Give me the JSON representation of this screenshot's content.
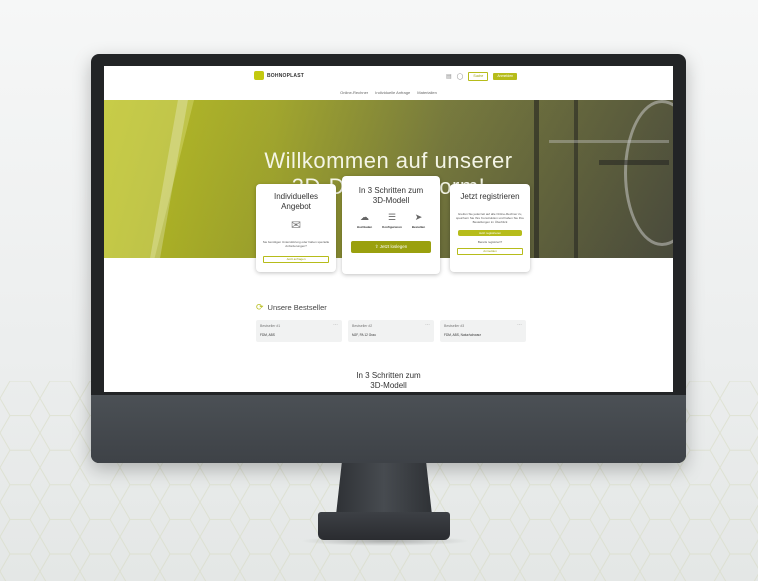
{
  "site": {
    "logo_text": "BOHNOPLAST"
  },
  "topbar": {
    "icon_compare": "chart-icon",
    "icon_user": "user-icon",
    "search_label": "Suche",
    "login_label": "Anmelden"
  },
  "nav": {
    "items": [
      "Online-Rechner",
      "Individuelle Anfrage",
      "Materialien"
    ]
  },
  "hero": {
    "title_line1": "Willkommen auf unserer",
    "title_line2": "3D-Druckplattform!"
  },
  "cards": {
    "individual": {
      "title_line1": "Individuelles",
      "title_line2": "Angebot",
      "text": "Sie benötigen Unterstützung oder haben spezielle Anforderungen?",
      "button": "Jetzt anfragen"
    },
    "steps": {
      "title_line1": "In 3 Schritten zum",
      "title_line2": "3D-Modell",
      "step1": "Hochladen",
      "step2": "Konfigurieren",
      "step3": "Bestellen",
      "button": "Jetzt loslegen"
    },
    "register": {
      "title": "Jetzt registrieren",
      "text": "Greifen Sie jederzeit auf alle Online-Rechner zu, speichern Sie Ihre Konstruktion und haben Sie Ihre Bestellungen im Überblick",
      "button": "Jetzt registrieren",
      "already": "Bereits registriert?",
      "login_button": "Anmelden"
    }
  },
  "bestseller": {
    "title": "Unsere Bestseller",
    "items": [
      {
        "label": "Bestseller #1",
        "text": "FDM, ABS"
      },
      {
        "label": "Bestseller #2",
        "text": "MJF, PA 12 Grau"
      },
      {
        "label": "Bestseller #3",
        "text": "FDM, ABS, Natur/schwarz"
      }
    ]
  },
  "section2": {
    "title_line1": "In 3 Schritten zum",
    "title_line2": "3D-Modell"
  },
  "colors": {
    "accent": "#b6bc1a",
    "accent_dark": "#9aa00e",
    "bezel": "#222426"
  }
}
